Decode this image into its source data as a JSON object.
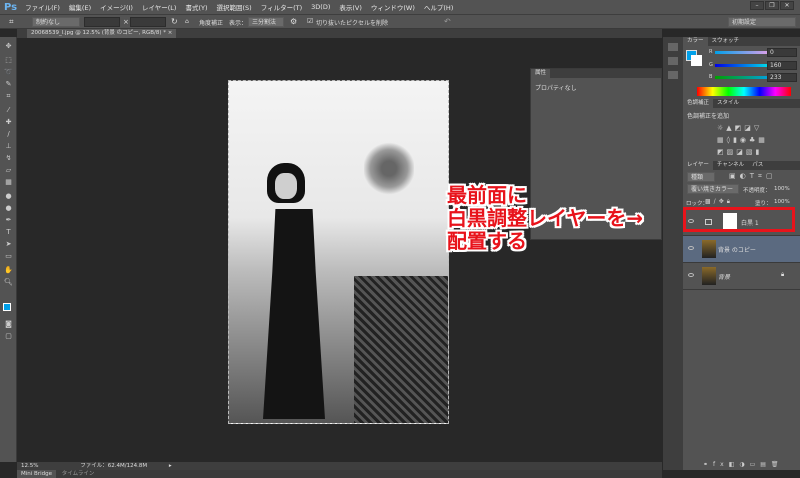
{
  "app": {
    "logo": "Ps"
  },
  "menu": [
    "ファイル(F)",
    "編集(E)",
    "イメージ(I)",
    "レイヤー(L)",
    "書式(Y)",
    "選択範囲(S)",
    "フィルター(T)",
    "3D(D)",
    "表示(V)",
    "ウィンドウ(W)",
    "ヘルプ(H)"
  ],
  "window_controls": {
    "minimize": "–",
    "restore": "❐",
    "close": "✕"
  },
  "options": {
    "ratio": "制約なし",
    "x_sep": "×",
    "straighten": "角度補正",
    "view_label": "表示：",
    "view_value": "三分割法",
    "delete_cropped": "切り抜いたピクセルを削除",
    "workspace": "初期設定"
  },
  "document_tab": {
    "title": "20068539_l.jpg @ 12.5% (背景 のコピー, RGB/8) *",
    "close": "×"
  },
  "properties": {
    "tab": "属性",
    "content": "プロパティなし"
  },
  "color_panel": {
    "tabs": [
      "カラー",
      "スウォッチ"
    ],
    "channels": [
      {
        "label": "R",
        "value": "0"
      },
      {
        "label": "G",
        "value": "160"
      },
      {
        "label": "B",
        "value": "233"
      }
    ],
    "foreground": "#00a0e9"
  },
  "adjustments": {
    "tabs": [
      "色調補正",
      "スタイル"
    ],
    "add_label": "色調補正を追加"
  },
  "layers": {
    "tabs": [
      "レイヤー",
      "チャンネル",
      "パス"
    ],
    "filter": "種類",
    "blend_mode": "覆い焼きカラー",
    "opacity_label": "不透明度：",
    "opacity": "100%",
    "lock_label": "ロック：",
    "fill_label": "塗り：",
    "fill": "100%",
    "items": [
      {
        "name": "白黒 1"
      },
      {
        "name": "背景 のコピー"
      },
      {
        "name": "背景"
      }
    ]
  },
  "status": {
    "zoom": "12.5%",
    "file": "ファイル：62.4M/124.8M"
  },
  "bottom_tabs": [
    "Mini Bridge",
    "タイムライン"
  ],
  "annotation": {
    "text": "最前面に\n白黒調整レイヤーを→\n配置する",
    "color": "#e8131b"
  }
}
